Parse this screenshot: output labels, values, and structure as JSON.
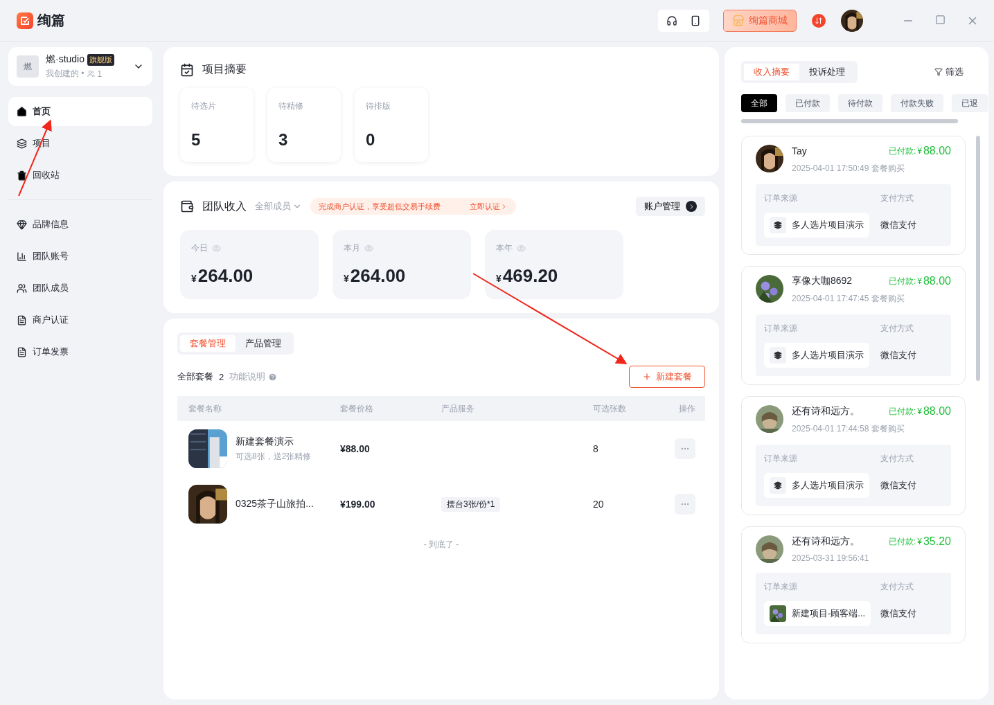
{
  "app": {
    "name": "绚篇"
  },
  "topbar": {
    "store_button": "绚篇商城"
  },
  "team": {
    "avatar_text": "燃",
    "name": "燃·studio",
    "badge": "旗舰版",
    "meta": "我创建的 •",
    "member_count": "1"
  },
  "sidebar": {
    "primary": [
      {
        "label": "首页",
        "selected": true
      },
      {
        "label": "项目",
        "selected": false
      },
      {
        "label": "回收站",
        "selected": false
      }
    ],
    "secondary": [
      {
        "label": "品牌信息",
        "selected": false
      },
      {
        "label": "团队账号",
        "selected": false
      },
      {
        "label": "团队成员",
        "selected": false
      },
      {
        "label": "商户认证",
        "selected": false
      },
      {
        "label": "订单发票",
        "selected": false
      }
    ]
  },
  "summary": {
    "title": "项目摘要",
    "stats": [
      {
        "label": "待选片",
        "value": "5"
      },
      {
        "label": "待精修",
        "value": "3"
      },
      {
        "label": "待排版",
        "value": "0"
      }
    ]
  },
  "income": {
    "title": "团队收入",
    "member_filter": "全部成员",
    "notice": "完成商户认证，享受超低交易手续费",
    "notice_link": "立即认证",
    "account_button": "账户管理",
    "cards": [
      {
        "label": "今日",
        "currency": "¥",
        "amount": "264.00"
      },
      {
        "label": "本月",
        "currency": "¥",
        "amount": "264.00"
      },
      {
        "label": "本年",
        "currency": "¥",
        "amount": "469.20"
      }
    ]
  },
  "packages": {
    "tabs": [
      {
        "label": "套餐管理",
        "selected": true
      },
      {
        "label": "产品管理",
        "selected": false
      }
    ],
    "count_label": "全部套餐",
    "count": "2",
    "help_link": "功能说明",
    "new_button": "新建套餐",
    "columns": [
      "套餐名称",
      "套餐价格",
      "产品服务",
      "可选张数",
      "操作"
    ],
    "rows": [
      {
        "name": "新建套餐演示",
        "subtitle": "可选8张，送2张精修",
        "price": "¥88.00",
        "photos": "8"
      },
      {
        "name": "0325茶子山旅拍...",
        "price": "¥199.00",
        "service": "摆台3张/份*1",
        "photos": "20"
      }
    ],
    "end_text": "- 到底了 -"
  },
  "orders": {
    "tabs": [
      {
        "label": "收入摘要",
        "selected": true
      },
      {
        "label": "投诉处理",
        "selected": false
      }
    ],
    "filter": "筛选",
    "chips": [
      {
        "label": "全部",
        "selected": true
      },
      {
        "label": "已付款",
        "selected": false
      },
      {
        "label": "待付款",
        "selected": false
      },
      {
        "label": "付款失败",
        "selected": false
      },
      {
        "label": "已退",
        "selected": false
      }
    ],
    "cards": [
      {
        "customer": "Tay",
        "status": "已付款:",
        "currency": "¥",
        "amount": "88.00",
        "time": "2025-04-01 17:50:49 套餐购买",
        "source_label": "订单来源",
        "source": "多人选片项目演示",
        "payment_label": "支付方式",
        "payment": "微信支付"
      },
      {
        "customer": "享像大咖8692",
        "status": "已付款:",
        "currency": "¥",
        "amount": "88.00",
        "time": "2025-04-01 17:47:45 套餐购买",
        "source_label": "订单来源",
        "source": "多人选片项目演示",
        "payment_label": "支付方式",
        "payment": "微信支付"
      },
      {
        "customer": "还有诗和远方。",
        "status": "已付款:",
        "currency": "¥",
        "amount": "88.00",
        "time": "2025-04-01 17:44:58 套餐购买",
        "source_label": "订单来源",
        "source": "多人选片项目演示",
        "payment_label": "支付方式",
        "payment": "微信支付"
      },
      {
        "customer": "还有诗和远方。",
        "status": "已付款:",
        "currency": "¥",
        "amount": "35.20",
        "time": "2025-03-31 19:56:41",
        "source_label": "订单来源",
        "source": "新建项目-顾客端...",
        "payment_label": "支付方式",
        "payment": "微信支付"
      }
    ]
  }
}
